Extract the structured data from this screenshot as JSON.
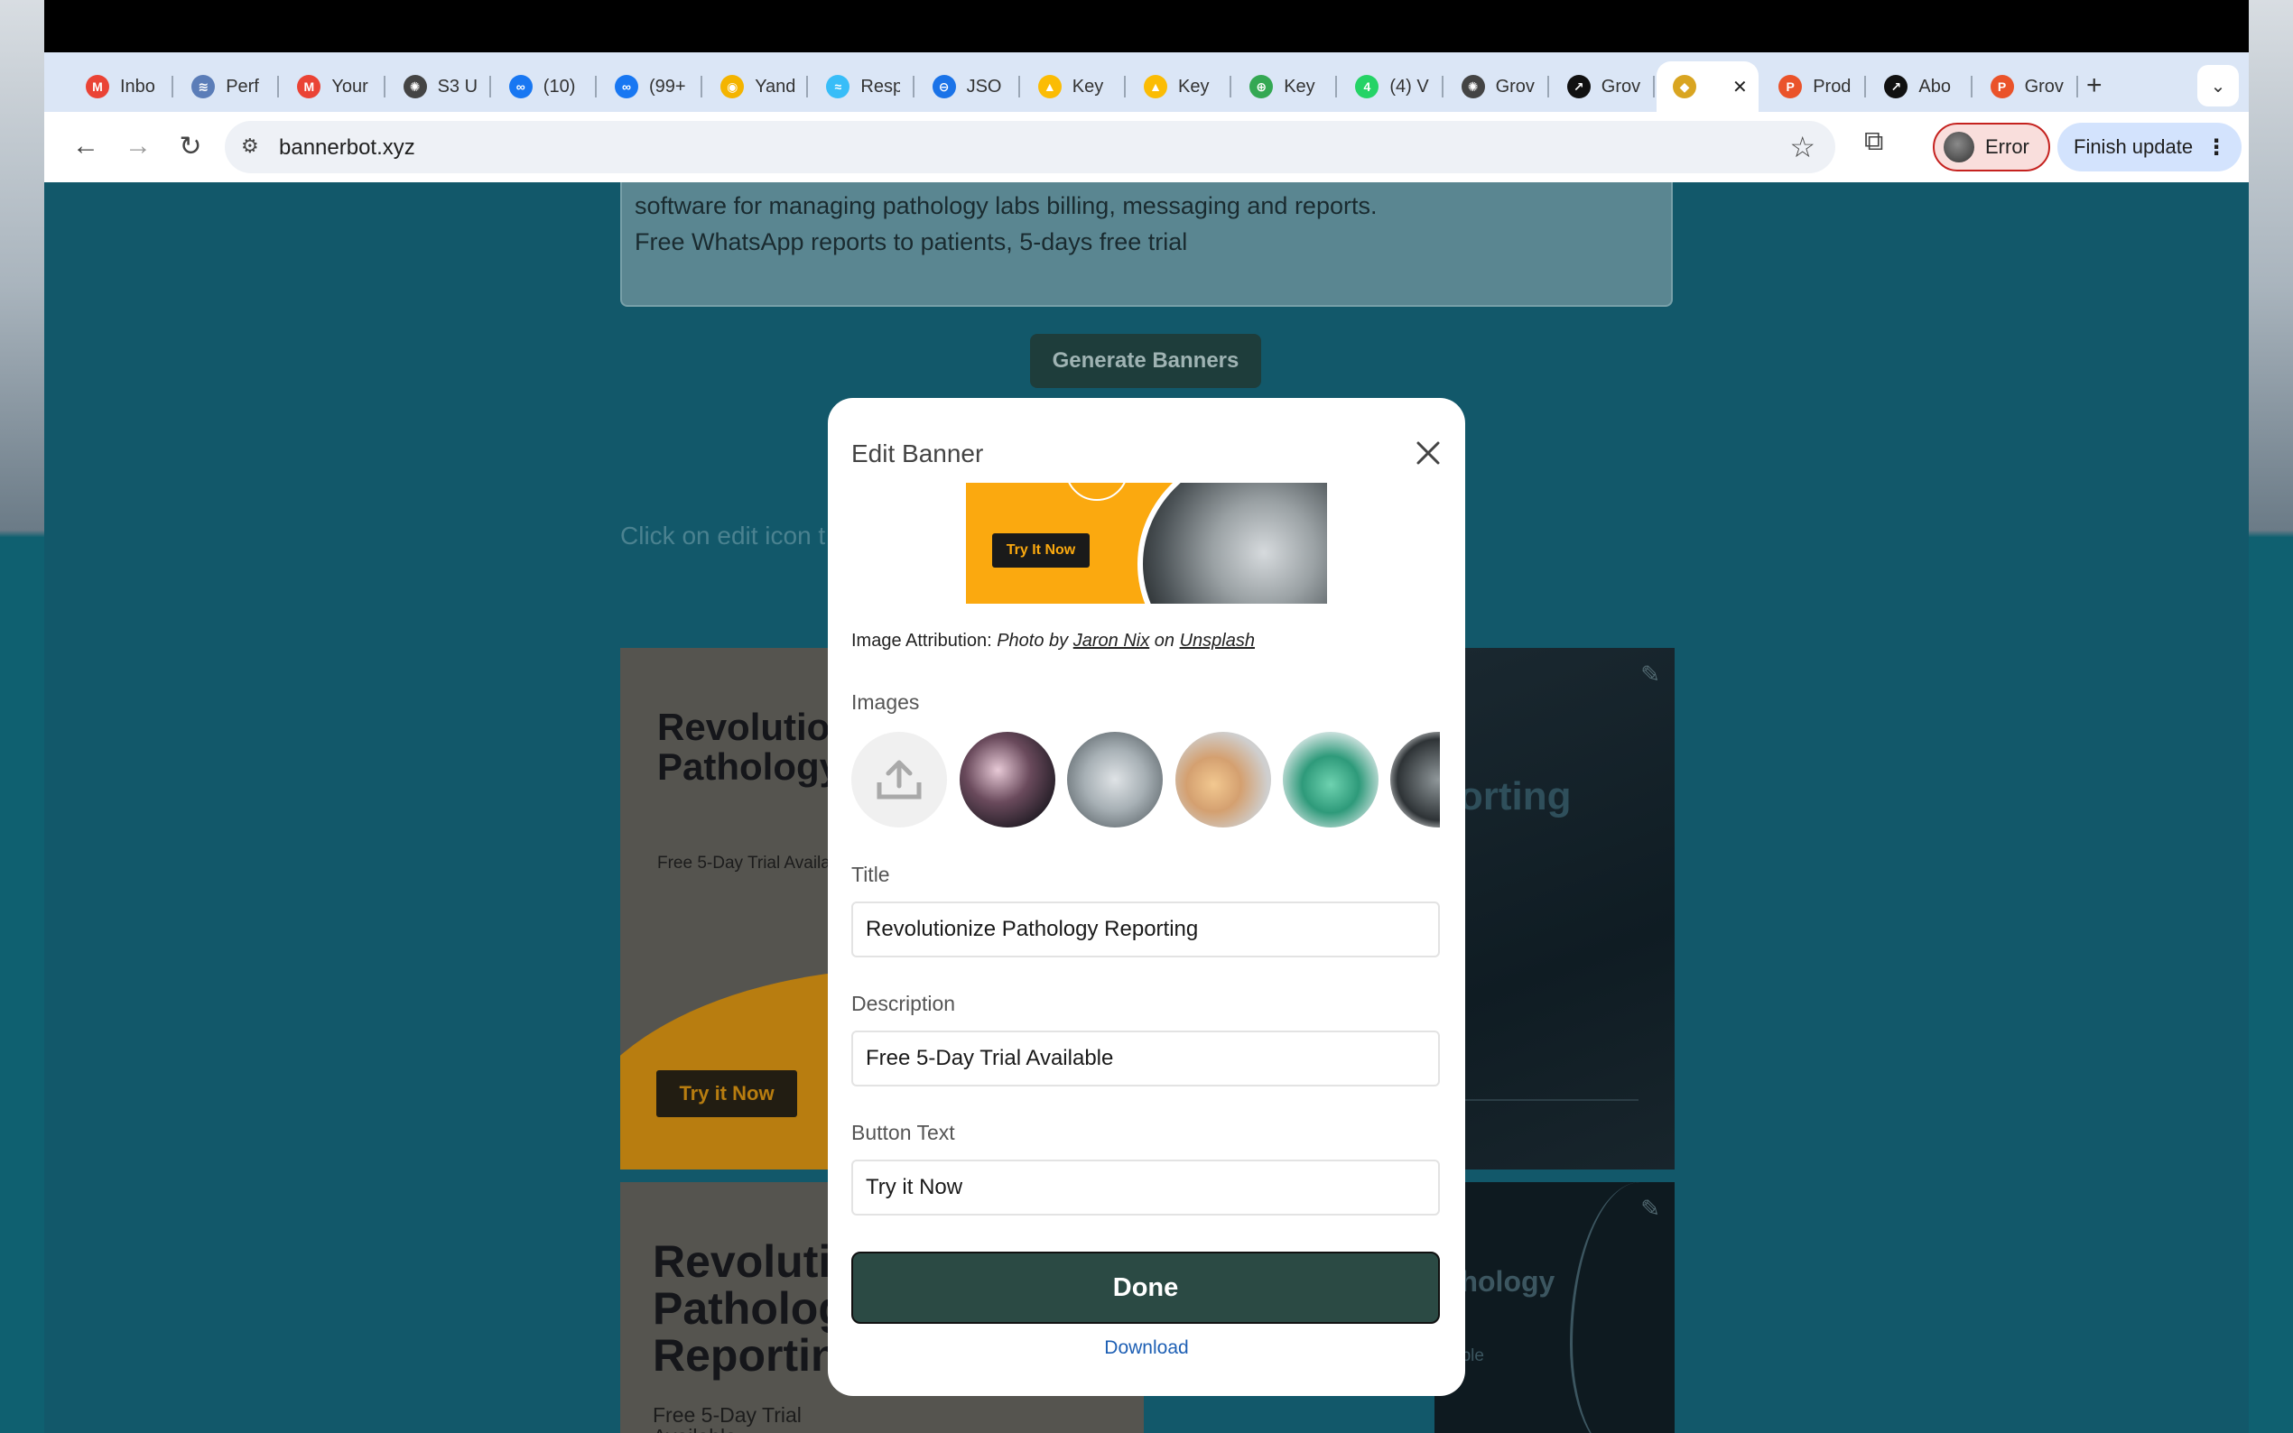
{
  "browser": {
    "tabs": [
      {
        "label": "Inbo",
        "icon": "gmail-icon",
        "color": "#ea4335",
        "glyph": "M"
      },
      {
        "label": "Perf",
        "icon": "perf-icon",
        "color": "#5b7db8",
        "glyph": "≋"
      },
      {
        "label": "Your",
        "icon": "gmail-icon",
        "color": "#ea4335",
        "glyph": "M"
      },
      {
        "label": "S3 U",
        "icon": "openai-icon",
        "color": "#444444",
        "glyph": "✺"
      },
      {
        "label": "(10)",
        "icon": "meta-icon",
        "color": "#1877f2",
        "glyph": "∞"
      },
      {
        "label": "(99+",
        "icon": "meta-icon",
        "color": "#1877f2",
        "glyph": "∞"
      },
      {
        "label": "Yand",
        "icon": "yandex-icon",
        "color": "#f4b400",
        "glyph": "◉"
      },
      {
        "label": "Resp",
        "icon": "tailwind-icon",
        "color": "#38bdf8",
        "glyph": "≈"
      },
      {
        "label": "JSO",
        "icon": "json-icon",
        "color": "#1a73e8",
        "glyph": "⊖"
      },
      {
        "label": "Key",
        "icon": "google-ads-icon",
        "color": "#fbbc04",
        "glyph": "▲"
      },
      {
        "label": "Key",
        "icon": "google-ads-icon",
        "color": "#fbbc04",
        "glyph": "▲"
      },
      {
        "label": "Key",
        "icon": "keyword-icon",
        "color": "#34a853",
        "glyph": "⊕"
      },
      {
        "label": "(4) V",
        "icon": "whatsapp-icon",
        "color": "#25d366",
        "glyph": "4"
      },
      {
        "label": "Grov",
        "icon": "openai-icon",
        "color": "#444444",
        "glyph": "✺"
      },
      {
        "label": "Grov",
        "icon": "growth-icon",
        "color": "#111111",
        "glyph": "↗"
      },
      {
        "label": "",
        "icon": "bannerbot-icon",
        "color": "#d9a521",
        "glyph": "◆",
        "active": true
      },
      {
        "label": "Prod",
        "icon": "producthunt-icon",
        "color": "#ea532a",
        "glyph": "P"
      },
      {
        "label": "Abo",
        "icon": "growth-icon",
        "color": "#111111",
        "glyph": "↗"
      },
      {
        "label": "Grov",
        "icon": "producthunt-icon",
        "color": "#ea532a",
        "glyph": "P"
      }
    ],
    "url": "bannerbot.xyz",
    "profile_status": "Error",
    "update_label": "Finish update"
  },
  "page": {
    "prompt_lines": [
      "software for managing pathology labs billing, messaging and reports.",
      "Free WhatsApp reports to patients, 5-days free trial"
    ],
    "generate_label": "Generate Banners",
    "hint": "Click on edit icon t",
    "cards": {
      "card1": {
        "title_lines": [
          "Revolutio",
          "Pathology"
        ],
        "description": "Free 5-Day Trial Availa",
        "button": "Try it Now"
      },
      "card2": {
        "title": "porting"
      },
      "card3": {
        "title_lines": [
          "Revoluti",
          "Patholog",
          "Reportin"
        ],
        "description_lines": [
          "Free 5-Day Trial",
          "Available"
        ]
      },
      "card4": {
        "title_lines": [
          "athology",
          "g"
        ],
        "description": "ailable"
      }
    }
  },
  "modal": {
    "title": "Edit Banner",
    "preview_button": "Try It Now",
    "attribution": {
      "prefix": "Image Attribution:",
      "photo_by": "Photo by",
      "author": "Jaron Nix",
      "on": "on",
      "source": "Unsplash"
    },
    "images_label": "Images",
    "title_label": "Title",
    "title_value": "Revolutionize Pathology Reporting",
    "description_label": "Description",
    "description_value": "Free 5-Day Trial Available",
    "button_text_label": "Button Text",
    "button_text_value": "Try it Now",
    "done_label": "Done",
    "download_label": "Download"
  }
}
